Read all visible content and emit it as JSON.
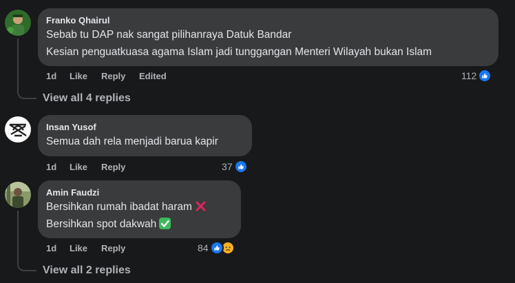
{
  "comments": [
    {
      "author": "Franko Qhairul",
      "lines": [
        "Sebab tu DAP nak sangat pilihanraya Datuk Bandar",
        "Kesian penguatkuasa agama Islam jadi tunggangan Menteri Wilayah bukan Islam"
      ],
      "time": "1d",
      "like_label": "Like",
      "reply_label": "Reply",
      "edited_label": "Edited",
      "reaction_count": "112",
      "reactions": [
        "like-icon"
      ],
      "view_replies": "View all 4 replies"
    },
    {
      "author": "Insan Yusof",
      "lines": [
        "Semua dah rela menjadi barua kapir"
      ],
      "time": "1d",
      "like_label": "Like",
      "reply_label": "Reply",
      "reaction_count": "37",
      "reactions": [
        "like-icon"
      ]
    },
    {
      "author": "Amin Faudzi",
      "lines": [
        "Bersihkan rumah ibadat haram",
        "Bersihkan spot dakwah"
      ],
      "line_emojis": [
        "cross-mark-icon",
        "check-mark-icon"
      ],
      "time": "1d",
      "like_label": "Like",
      "reply_label": "Reply",
      "reaction_count": "84",
      "reactions": [
        "like-icon",
        "sad-icon"
      ],
      "view_replies": "View all 2 replies"
    }
  ],
  "colors": {
    "background": "#18191a",
    "bubble": "#3a3b3c",
    "primary_text": "#e4e6eb",
    "secondary_text": "#b0b3b8",
    "like_blue": "#1877f2",
    "sad_yellow": "#f7b125",
    "check_green": "#3dba5c",
    "cross_red": "#e0245e"
  }
}
